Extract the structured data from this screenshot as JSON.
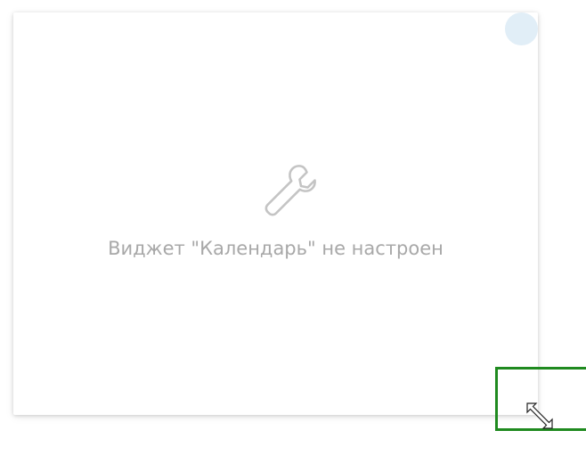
{
  "widget": {
    "empty_message": "Виджет \"Календарь\" не настроен",
    "icon": "wrench-icon"
  },
  "status_indicator": {
    "color": "#e1eef7"
  },
  "resize_handle": {
    "icon": "diagonal-resize-cursor-icon",
    "highlight_color": "#1f8a1f"
  },
  "colors": {
    "message_text": "#a8a8a8",
    "icon_stroke": "#c4c4c4",
    "card_background": "#ffffff"
  }
}
